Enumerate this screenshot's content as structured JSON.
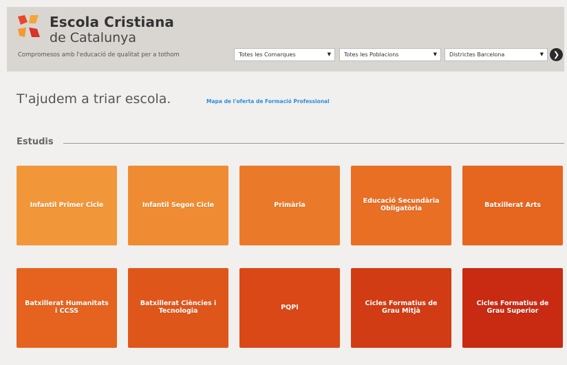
{
  "brand": {
    "line1": "Escola Cristiana",
    "line2": "de Catalunya",
    "tagline": "Compromesos amb l'educació de qualitat per a tothom"
  },
  "filters": {
    "comarques": "Totes les Comarques",
    "poblacions": "Totes les Poblacions",
    "districtes": "Districtes Barcelona",
    "arrow": "▼",
    "go": "❯"
  },
  "main": {
    "title": "T'ajudem a triar escola.",
    "fp_link": "Mapa de l'oferta de Formació Professional",
    "section": "Estudis"
  },
  "tiles": [
    {
      "label": "Infantil Primer Cicle",
      "color": "#f1973a"
    },
    {
      "label": "Infantil Segon Cicle",
      "color": "#ef8c33"
    },
    {
      "label": "Primària",
      "color": "#ea7a2a"
    },
    {
      "label": "Educació Secundària Obligatòria",
      "color": "#e86f24"
    },
    {
      "label": "Batxillerat Arts",
      "color": "#e6661f"
    },
    {
      "label": "Batxillerat Humanitats i CCSS",
      "color": "#e5631e"
    },
    {
      "label": "Batxillerat Ciències i Tecnologia",
      "color": "#df561b"
    },
    {
      "label": "PQPI",
      "color": "#d94816"
    },
    {
      "label": "Cicles Formatius de Grau Mitjà",
      "color": "#d23c14"
    },
    {
      "label": "Cicles Formatius de Grau Superior",
      "color": "#c82a12"
    }
  ],
  "logo_colors": [
    "#e8462a",
    "#f4a53a",
    "#f39a2e",
    "#d8342a"
  ]
}
